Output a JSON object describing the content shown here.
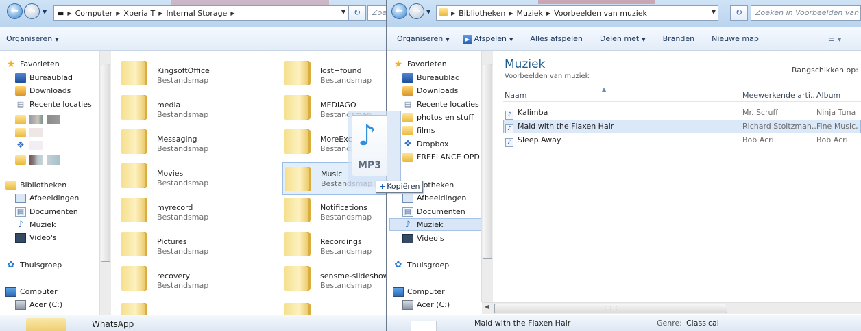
{
  "left_window": {
    "address": {
      "segments": [
        "Computer",
        "Xperia T",
        "Internal Storage"
      ],
      "search_placeholder": "Zoe"
    },
    "toolbar": {
      "organize": "Organiseren"
    },
    "nav": {
      "favorites": "Favorieten",
      "items": [
        "Bureaublad",
        "Downloads",
        "Recente locaties"
      ],
      "libraries": "Bibliotheken",
      "lib_items": [
        "Afbeeldingen",
        "Documenten",
        "Muziek",
        "Video's"
      ],
      "homegroup": "Thuisgroep",
      "computer": "Computer",
      "drive": "Acer (C:)"
    },
    "folders_col1": [
      {
        "name": "KingsoftOffice",
        "type": "Bestandsmap"
      },
      {
        "name": "media",
        "type": "Bestandsmap"
      },
      {
        "name": "Messaging",
        "type": "Bestandsmap"
      },
      {
        "name": "Movies",
        "type": "Bestandsmap"
      },
      {
        "name": "myrecord",
        "type": "Bestandsmap"
      },
      {
        "name": "Pictures",
        "type": "Bestandsmap"
      },
      {
        "name": "recovery",
        "type": "Bestandsmap"
      }
    ],
    "folders_col2": [
      {
        "name": "lost+found",
        "type": "Bestandsmap"
      },
      {
        "name": "MEDIAGO",
        "type": "Bestandsmap"
      },
      {
        "name": "MoreExchange",
        "type": "Bestandsmap"
      },
      {
        "name": "Music",
        "type": "Bestandsmap"
      },
      {
        "name": "Notifications",
        "type": "Bestandsmap"
      },
      {
        "name": "Recordings",
        "type": "Bestandsmap"
      },
      {
        "name": "sensme-slideshow",
        "type": "Bestandsmap"
      }
    ],
    "status": {
      "selected_name": "WhatsApp"
    }
  },
  "right_window": {
    "address": {
      "segments": [
        "Bibliotheken",
        "Muziek",
        "Voorbeelden van muziek"
      ],
      "search_placeholder": "Zoeken in Voorbeelden van mu"
    },
    "toolbar": {
      "organize": "Organiseren",
      "play": "Afspelen",
      "play_all": "Alles afspelen",
      "share": "Delen met",
      "burn": "Branden",
      "new_folder": "Nieuwe map"
    },
    "nav": {
      "favorites": "Favorieten",
      "items": [
        "Bureaublad",
        "Downloads",
        "Recente locaties",
        "photos en stuff",
        "films",
        "Dropbox",
        "FREELANCE OPD"
      ],
      "libraries": "Bibliotheken",
      "lib_items": [
        "Afbeeldingen",
        "Documenten",
        "Muziek",
        "Video's"
      ],
      "homegroup": "Thuisgroep",
      "computer": "Computer",
      "drive": "Acer (C:)"
    },
    "library": {
      "title": "Muziek",
      "subtitle": "Voorbeelden van muziek",
      "arrange_label": "Rangschikken op:"
    },
    "columns": [
      "Naam",
      "Meewerkende arti...",
      "Album"
    ],
    "rows": [
      {
        "name": "Kalimba",
        "artist": "Mr. Scruff",
        "album": "Ninja Tuna"
      },
      {
        "name": "Maid with the Flaxen Hair",
        "artist": "Richard Stoltzman...",
        "album": "Fine Music,"
      },
      {
        "name": "Sleep Away",
        "artist": "Bob Acri",
        "album": "Bob Acri"
      }
    ],
    "details": {
      "name": "Maid with the Flaxen Hair",
      "genre_label": "Genre:",
      "genre_value": "Classical"
    }
  },
  "drag": {
    "badge": "MP3",
    "tooltip": "Kopiëren"
  },
  "colors": {
    "accent": "#1d5c8f",
    "selection": "#dbe8f8",
    "titlebar": "#c4dbf2"
  }
}
